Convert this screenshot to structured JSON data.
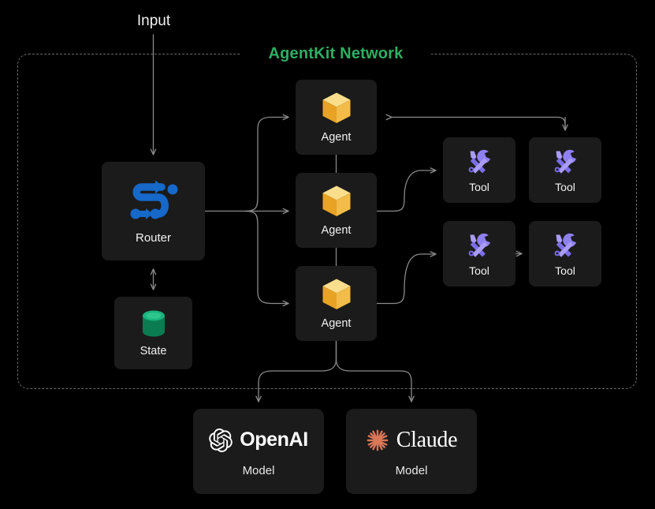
{
  "diagram": {
    "title": "AgentKit Network",
    "title_color": "#2eae63",
    "background_color": "#000000",
    "card_color": "#1b1b1b",
    "connector_color": "#8a8a8a",
    "frame_border_color": "#6b6b6b"
  },
  "input": {
    "label": "Input"
  },
  "router": {
    "label": "Router",
    "icon": "route-icon",
    "icon_color": "#1668c9"
  },
  "state": {
    "label": "State",
    "icon": "database-cylinder-icon",
    "icon_color": "#0e9463"
  },
  "agents": [
    {
      "label": "Agent",
      "icon": "cube-icon",
      "icon_color": "#f0b429"
    },
    {
      "label": "Agent",
      "icon": "cube-icon",
      "icon_color": "#f0b429"
    },
    {
      "label": "Agent",
      "icon": "cube-icon",
      "icon_color": "#f0b429"
    }
  ],
  "tools": [
    {
      "label": "Tool",
      "icon": "wrench-screwdriver-icon",
      "icon_color": "#8b7ef0"
    },
    {
      "label": "Tool",
      "icon": "wrench-screwdriver-icon",
      "icon_color": "#8b7ef0"
    },
    {
      "label": "Tool",
      "icon": "wrench-screwdriver-icon",
      "icon_color": "#8b7ef0"
    },
    {
      "label": "Tool",
      "icon": "wrench-screwdriver-icon",
      "icon_color": "#8b7ef0"
    }
  ],
  "models": [
    {
      "brand": "OpenAI",
      "label": "Model",
      "icon": "openai-logo-icon",
      "icon_color": "#ffffff"
    },
    {
      "brand": "Claude",
      "label": "Model",
      "icon": "claude-starburst-icon",
      "icon_color": "#d97757"
    }
  ]
}
